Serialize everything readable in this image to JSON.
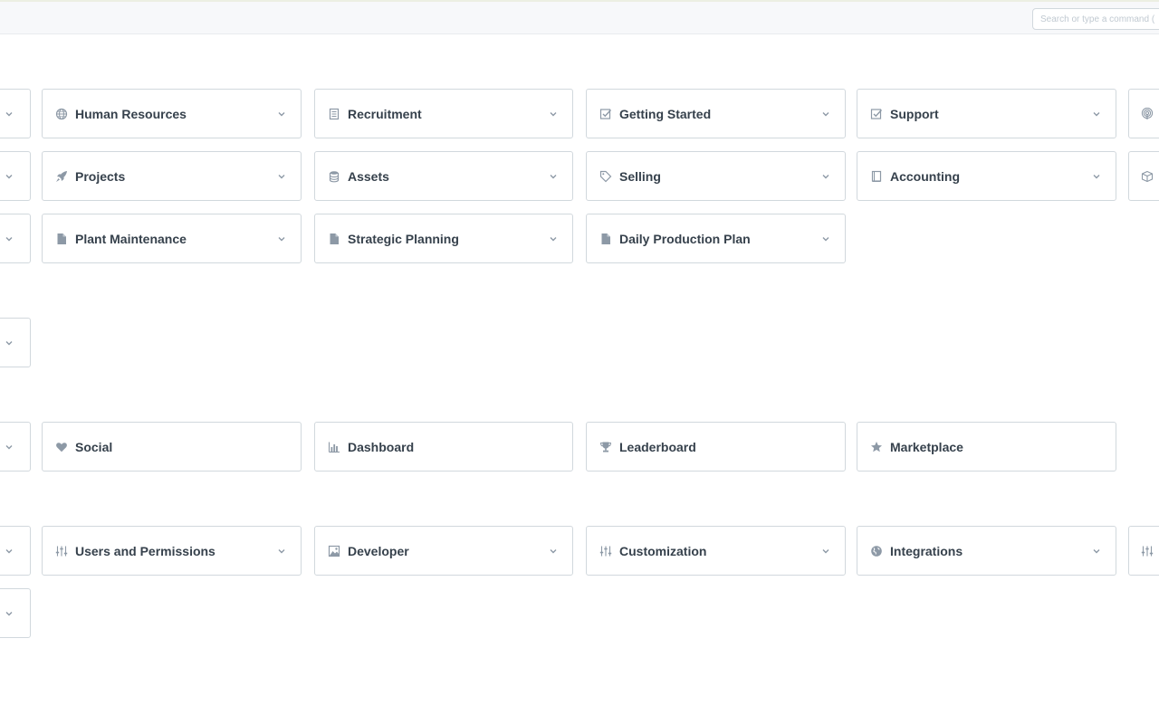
{
  "search": {
    "placeholder": "Search or type a command ("
  },
  "colors": {
    "border": "#d1d8dd",
    "icon": "#8d99a6",
    "text": "#36414c",
    "topbar": "#f7f8fa"
  },
  "modules": [
    {
      "label": "Human Resources",
      "icon": "globe-icon"
    },
    {
      "label": "Recruitment",
      "icon": "document-icon"
    },
    {
      "label": "Getting Started",
      "icon": "checkbox-icon"
    },
    {
      "label": "Support",
      "icon": "checkbox-icon"
    },
    {
      "label": "Projects",
      "icon": "rocket-icon"
    },
    {
      "label": "Assets",
      "icon": "database-icon"
    },
    {
      "label": "Selling",
      "icon": "tag-icon"
    },
    {
      "label": "Accounting",
      "icon": "book-icon"
    },
    {
      "label": "Plant Maintenance",
      "icon": "file-icon"
    },
    {
      "label": "Strategic Planning",
      "icon": "file-icon"
    },
    {
      "label": "Daily Production Plan",
      "icon": "file-icon"
    }
  ],
  "places": [
    {
      "label": "Social",
      "icon": "heart-icon"
    },
    {
      "label": "Dashboard",
      "icon": "bar-chart-icon"
    },
    {
      "label": "Leaderboard",
      "icon": "trophy-icon"
    },
    {
      "label": "Marketplace",
      "icon": "star-icon"
    }
  ],
  "administration": [
    {
      "label": "Users and Permissions",
      "icon": "sliders-icon"
    },
    {
      "label": "Developer",
      "icon": "image-icon"
    },
    {
      "label": "Customization",
      "icon": "sliders-icon"
    },
    {
      "label": "Integrations",
      "icon": "earth-icon"
    }
  ]
}
